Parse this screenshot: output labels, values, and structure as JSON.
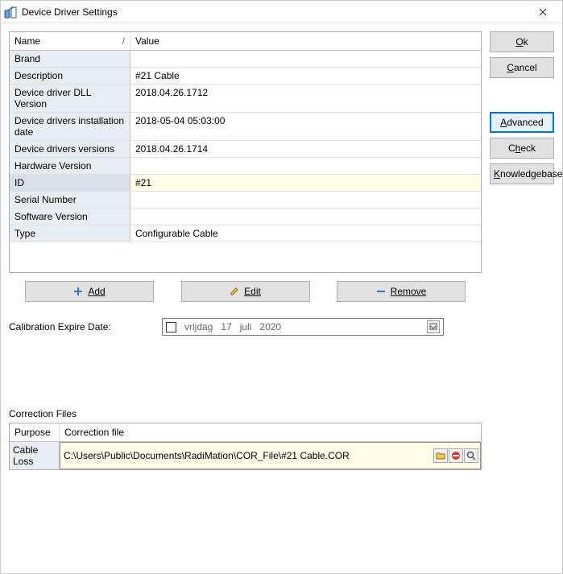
{
  "window": {
    "title": "Device Driver Settings"
  },
  "grid": {
    "columns": {
      "name": "Name",
      "value": "Value"
    },
    "rows": [
      {
        "name": "Brand",
        "value": ""
      },
      {
        "name": "Description",
        "value": "#21 Cable"
      },
      {
        "name": "Device driver DLL Version",
        "value": "2018.04.26.1712"
      },
      {
        "name": "Device drivers installation date",
        "value": "2018-05-04 05:03:00"
      },
      {
        "name": "Device drivers versions",
        "value": "2018.04.26.1714"
      },
      {
        "name": "Hardware Version",
        "value": ""
      },
      {
        "name": "ID",
        "value": "#21"
      },
      {
        "name": "Serial Number",
        "value": ""
      },
      {
        "name": "Software Version",
        "value": ""
      },
      {
        "name": "Type",
        "value": "Configurable Cable"
      }
    ],
    "selectedIndex": 6
  },
  "actions": {
    "add": "Add",
    "edit": "Edit",
    "remove": "Remove"
  },
  "calibration": {
    "label": "Calibration Expire Date:",
    "date": {
      "weekday": "vrijdag",
      "day": "17",
      "month": "juli",
      "year": "2020"
    },
    "checked": false
  },
  "correction": {
    "section_label": "Correction Files",
    "columns": {
      "purpose": "Purpose",
      "file": "Correction file"
    },
    "rows": [
      {
        "purpose": "Cable Loss",
        "file": "C:\\Users\\Public\\Documents\\RadiMation\\COR_File\\#21 Cable.COR"
      }
    ]
  },
  "sidebar": {
    "ok": "Ok",
    "cancel": "Cancel",
    "advanced": "Advanced",
    "check": "Check",
    "knowledgebase": "Knowledgebase"
  }
}
